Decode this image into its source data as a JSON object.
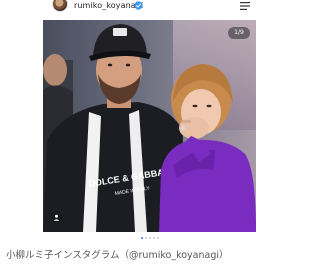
{
  "header": {
    "username": "rumiko_koyanagi",
    "verified_icon": "verified-badge-icon",
    "menu_icon": "hamburger-menu-icon"
  },
  "post": {
    "page_counter": "1/9",
    "current_slide": 1,
    "total_slides": 9,
    "print_text": "DOLCE & GABBANA",
    "print_subtext": "MADE IN ITALY",
    "tag_icon": "person-tag-icon"
  },
  "colors": {
    "dot_active": "#3b82f6",
    "dot_inactive": "#c8c8c8",
    "sweater": "#7a2bc0"
  },
  "caption": "小柳ルミ子インスタグラム（@rumiko_koyanagi）"
}
